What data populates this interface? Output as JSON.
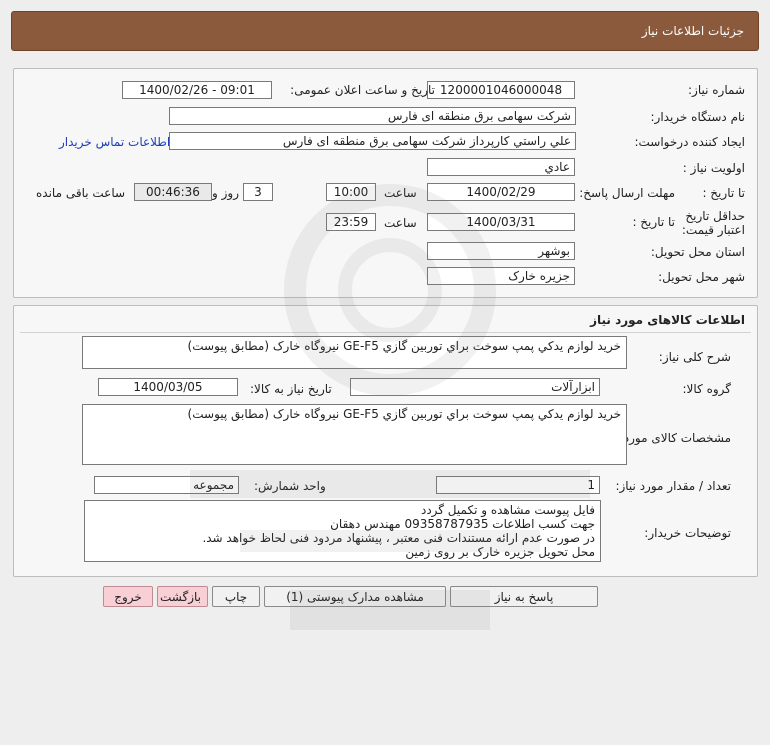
{
  "header": {
    "title": "جزئیات اطلاعات نیاز"
  },
  "info": {
    "need_number_label": "شماره نیاز:",
    "need_number": "1200001046000048",
    "announce_label": "تاریخ و ساعت اعلان عمومی:",
    "announce_value": "1400/02/26 - 09:01",
    "buyer_label": "نام دستگاه خریدار:",
    "buyer_value": "شرکت سهامی برق منطقه ای فارس",
    "creator_label": "ایجاد کننده درخواست:",
    "creator_value": "علي راستي كارپرداز شرکت سهامی برق منطقه ای فارس",
    "contact_link": "اطلاعات تماس خریدار",
    "priority_label": "اولویت نیاز :",
    "priority_value": "عادي",
    "deadline_label": "مهلت ارسال پاسخ:",
    "to_date_label": "تا تاریخ :",
    "deadline_date": "1400/02/29",
    "time_label": "ساعت",
    "deadline_time": "10:00",
    "days_value": "3",
    "days_label": "روز و",
    "remaining_time": "00:46:36",
    "remaining_label": "ساعت باقی مانده",
    "validity_label": "حداقل تاریخ اعتبار قیمت:",
    "validity_date": "1400/03/31",
    "validity_time": "23:59",
    "province_label": "استان محل تحویل:",
    "province_value": "بوشهر",
    "city_label": "شهر محل تحویل:",
    "city_value": "جزیره خارک"
  },
  "goods": {
    "section_title": "اطلاعات کالاهای مورد نیاز",
    "summary_label": "شرح کلی نیاز:",
    "summary_value": "خريد لوازم يدكي پمپ سوخت براي توربين گازي GE-F5 نيروگاه خارک (مطابق پيوست)",
    "group_label": "گروه کالا:",
    "group_value": "ابزارآلات",
    "need_date_label": "تاریخ نیاز به کالا:",
    "need_date_value": "1400/03/05",
    "spec_label": "مشخصات کالای مورد نیاز:",
    "spec_value": "خريد لوازم يدكي پمپ سوخت براي توربين گازي GE-F5 نيروگاه خارک (مطابق پيوست)",
    "qty_label": "تعداد / مقدار مورد نیاز:",
    "qty_value": "1",
    "unit_label": "واحد شمارش:",
    "unit_value": "مجموعه",
    "notes_label": "توضیحات خریدار:",
    "notes_value": "فایل پیوست مشاهده و تکمیل گردد\nجهت کسب اطلاعات 09358787935 مهندس دهقان\nدر صورت عدم ارائه مستندات فنی معتبر ، پیشنهاد مردود فنی لحاظ خواهد شد.\nمحل تحویل جزیره خارک بر روی زمین"
  },
  "buttons": {
    "reply": "پاسخ به نیاز",
    "attachments": "مشاهده مدارک پیوستی (1)",
    "print": "چاپ",
    "back": "بازگشت",
    "exit": "خروج"
  },
  "colors": {
    "header_bg": "#8b5a3c",
    "pink_button": "#f7cfd4"
  }
}
